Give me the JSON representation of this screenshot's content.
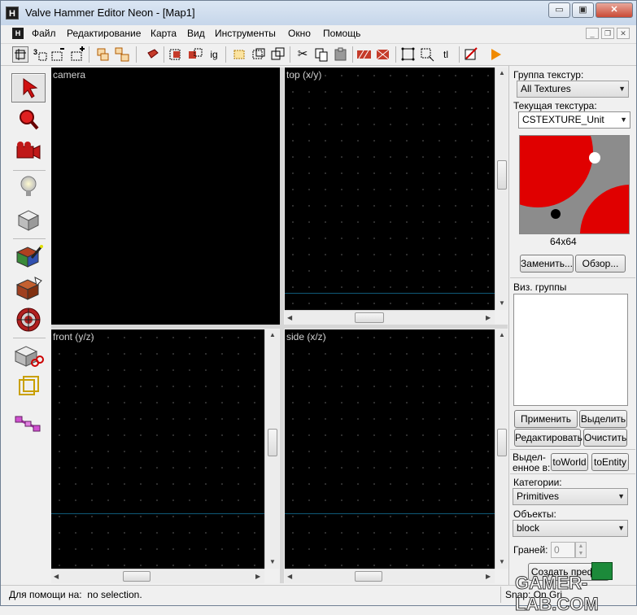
{
  "window": {
    "title": "Valve Hammer Editor Neon - [Map1]",
    "app_icon_letter": "H",
    "minimize": "▭",
    "maximize": "▣",
    "close": "✕"
  },
  "menu": {
    "items": [
      "Файл",
      "Редактирование",
      "Карта",
      "Вид",
      "Инструменты",
      "Окно",
      "Помощь"
    ],
    "mdi_min": "_",
    "mdi_restore": "❐",
    "mdi_close": "✕"
  },
  "toolbar": {
    "tools": [
      "grid-toggle",
      "grid-3d",
      "grid-smaller",
      "grid-larger",
      "group",
      "ungroup",
      "carve",
      "hollow-cube",
      "texture-lock",
      "ig",
      "hide-selected",
      "show-all",
      "cordon",
      "cut",
      "copy",
      "paste",
      "texture-app",
      "decal",
      "select-box",
      "select-entities",
      "tl",
      "compile",
      "run"
    ],
    "ig_label": "ig",
    "tl_label": "tl"
  },
  "palette": {
    "tools": [
      {
        "name": "selection-tool",
        "icon": "arrow-icon"
      },
      {
        "name": "magnify-tool",
        "icon": "magnifier-icon"
      },
      {
        "name": "camera-tool",
        "icon": "camera-icon"
      },
      {
        "name": "entity-tool",
        "icon": "lightbulb-icon"
      },
      {
        "name": "block-tool",
        "icon": "cube-icon"
      },
      {
        "name": "texture-application-tool",
        "icon": "texture-cube-icon"
      },
      {
        "name": "apply-texture-tool",
        "icon": "brick-cube-icon"
      },
      {
        "name": "decal-tool",
        "icon": "target-icon"
      },
      {
        "name": "clip-tool",
        "icon": "scissors-cube-icon"
      },
      {
        "name": "vertex-tool",
        "icon": "vertex-icon"
      },
      {
        "name": "path-tool",
        "icon": "path-icon"
      }
    ]
  },
  "viewports": {
    "camera": "camera",
    "top": "top (x/y)",
    "front": "front (y/z)",
    "side": "side (x/z)"
  },
  "right_panel": {
    "texture_group_label": "Группа текстур:",
    "texture_group_value": "All Textures",
    "current_texture_label": "Текущая текстура:",
    "current_texture_value": "CSTEXTURE_Unit",
    "texture_size": "64x64",
    "replace_button": "Заменить...",
    "browse_button": "Обзор...",
    "vis_groups_label": "Виз. группы",
    "apply_button": "Применить",
    "select_button": "Выделить",
    "edit_button": "Редактировать",
    "clear_button": "Очистить",
    "move_selected_label_1": "Выдел-",
    "move_selected_label_2": "енное в:",
    "to_world_button": "toWorld",
    "to_entity_button": "toEntity",
    "categories_label": "Категории:",
    "categories_value": "Primitives",
    "objects_label": "Объекты:",
    "objects_value": "block",
    "faces_label": "Граней:",
    "faces_value": "0",
    "create_prefab_button": "Создать префаб"
  },
  "status": {
    "help_text": "Для помощи на:  no selection.",
    "snap_text": "Snap: On Gri"
  },
  "watermark": "GAMER-LAB.COM",
  "colors": {
    "viewport_bg": "#000000",
    "axis_line": "#0f5a78",
    "texture_red": "#e00000",
    "texture_grey": "#8c8c8c"
  }
}
